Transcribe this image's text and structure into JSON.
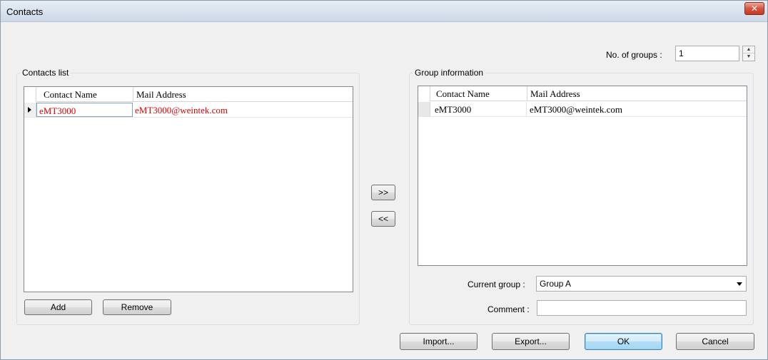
{
  "window": {
    "title": "Contacts",
    "close_symbol": "✕"
  },
  "groups_count": {
    "label": "No. of groups :",
    "value": "1"
  },
  "contacts_list": {
    "title": "Contacts list",
    "columns": [
      "Contact Name",
      "Mail Address"
    ],
    "rows": [
      {
        "name": "eMT3000",
        "mail": "eMT3000@weintek.com"
      }
    ],
    "add_label": "Add",
    "remove_label": "Remove"
  },
  "transfer": {
    "add_label": ">>",
    "remove_label": "<<"
  },
  "group_info": {
    "title": "Group information",
    "columns": [
      "Contact Name",
      "Mail Address"
    ],
    "rows": [
      {
        "name": "eMT3000",
        "mail": "eMT3000@weintek.com"
      }
    ],
    "current_group_label": "Current group :",
    "current_group_value": "Group A",
    "comment_label": "Comment :",
    "comment_value": ""
  },
  "footer": {
    "import_label": "Import...",
    "export_label": "Export...",
    "ok_label": "OK",
    "cancel_label": "Cancel"
  },
  "colors": {
    "selected_text": "#e00000",
    "title_bar": "#dbe4ef",
    "close_button": "#c23b22"
  }
}
